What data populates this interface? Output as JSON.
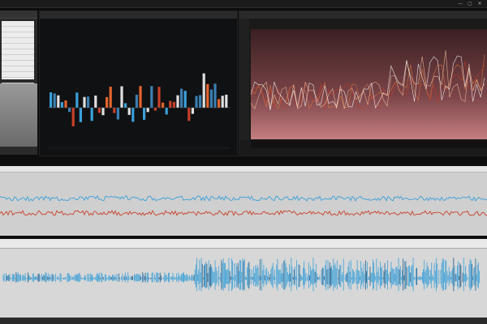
{
  "window": {
    "title": "",
    "controls": [
      "—",
      "▢",
      "✕"
    ]
  },
  "sidebar": {
    "header": ""
  },
  "panel_bars": {
    "title": "",
    "subtitle": ""
  },
  "panel_lines": {
    "title": ""
  },
  "strip": {
    "header": ""
  },
  "bottom": {
    "tab_labels": [
      "",
      "",
      "",
      "",
      "",
      "",
      "",
      ""
    ]
  },
  "colors": {
    "accent_blue": "#3aa0d8",
    "accent_red": "#c8402a",
    "accent_orange": "#e3652e",
    "bg_dark": "#101113"
  },
  "icons": [
    "minimize-icon",
    "maximize-icon",
    "close-icon"
  ]
}
